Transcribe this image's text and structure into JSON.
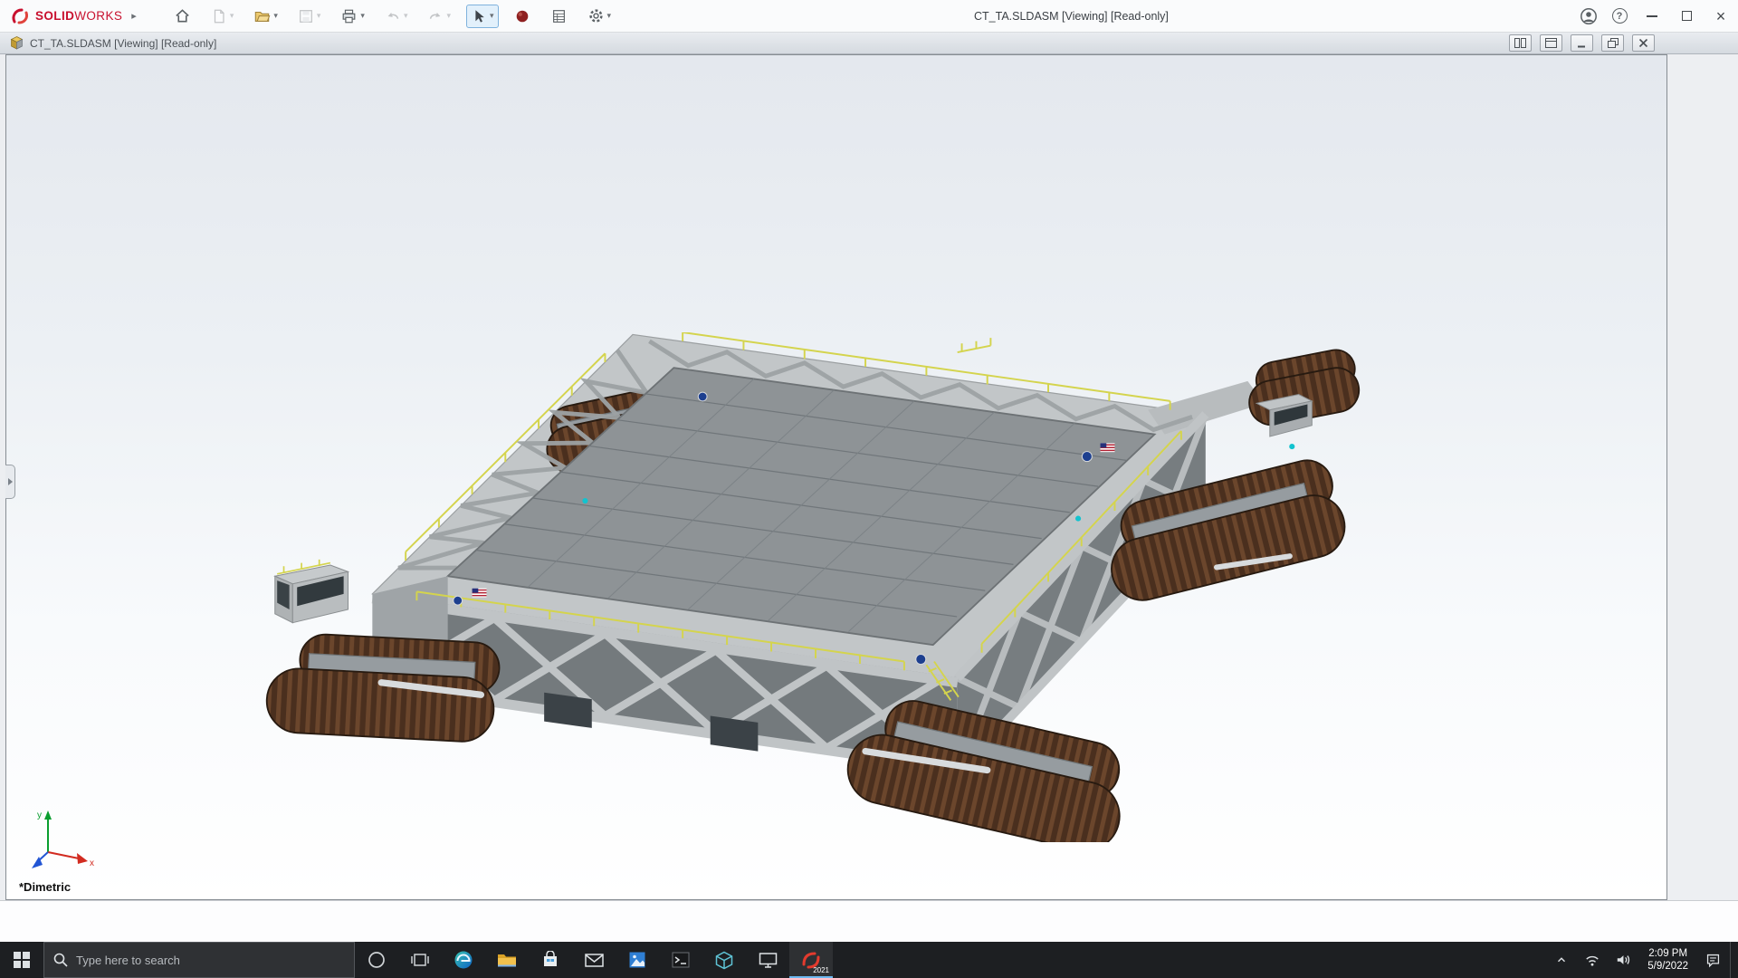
{
  "app": {
    "brand": {
      "bold": "SOLID",
      "light": "WORKS"
    },
    "title": "CT_TA.SLDASM [Viewing] [Read-only]"
  },
  "toolbar": {
    "icons": [
      "home",
      "new-document",
      "open",
      "save",
      "print",
      "undo",
      "redo",
      "select-cursor",
      "material-sphere",
      "evaluate-table",
      "options-gear"
    ]
  },
  "titlebar_controls": {
    "icons": [
      "account",
      "help",
      "minimize",
      "maximize",
      "close"
    ]
  },
  "document_window": {
    "title": "CT_TA.SLDASM [Viewing] [Read-only]",
    "controls": [
      "split-view",
      "tile-view",
      "minimize",
      "restore",
      "close"
    ]
  },
  "viewport": {
    "view_label": "*Dimetric",
    "triad": {
      "x": "x",
      "y": "y"
    }
  },
  "taskbar": {
    "search_placeholder": "Type here to search",
    "icons": [
      "start",
      "cortana",
      "task-view",
      "edge",
      "file-explorer",
      "store",
      "mail",
      "photos",
      "command-prompt",
      "3d-viewer",
      "display",
      "solidworks"
    ],
    "solidworks_badge": "2021",
    "tray_icons": [
      "hidden-icons-chevron",
      "network",
      "volume",
      "action-center"
    ],
    "clock": {
      "time": "2:09 PM",
      "date": "5/9/2022"
    }
  },
  "colors": {
    "brand_red": "#c8102e",
    "taskbar_bg": "#1d1f22",
    "viewport_top": "#e4e8ee",
    "deck_gray": "#8e9396",
    "track_brown": "#5e3c28",
    "rail_yellow": "#d4d44d"
  }
}
